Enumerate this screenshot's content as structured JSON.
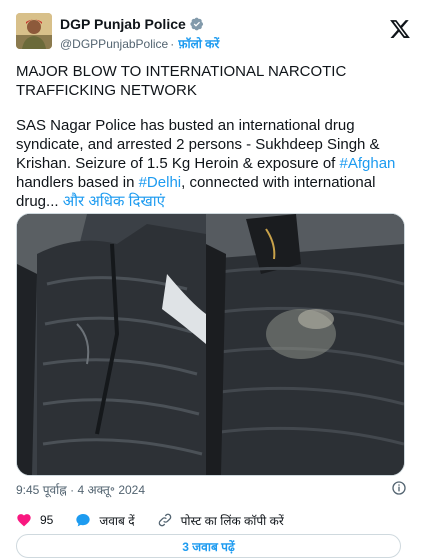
{
  "account": {
    "name": "DGP Punjab Police",
    "handle": "@DGPPunjabPolice",
    "separator": "·",
    "follow_label": "फ़ॉलो करें"
  },
  "tweet": {
    "headline": "MAJOR BLOW TO INTERNATIONAL NARCOTIC TRAFFICKING NETWORK",
    "body_part1": "SAS Nagar Police has busted an international drug syndicate, and arrested 2 persons - Sukhdeep Singh & Krishan. Seizure of 1.5 Kg Heroin & exposure of ",
    "hashtag1": "#Afghan",
    "body_part2": " handlers based in ",
    "hashtag2": "#Delhi",
    "body_part3": ", connected with international drug...",
    "show_more": "और अधिक दिखाएं"
  },
  "meta": {
    "time": "9:45 पूर्वाह्न",
    "separator": "·",
    "date": "4 अक्तू॰ 2024"
  },
  "actions": {
    "likes": "95",
    "reply_label": "जवाब दें",
    "copy_link_label": "पोस्ट का लिंक कॉपी करें"
  },
  "replies_button": "3 जवाब पढ़ें",
  "colors": {
    "accent": "#1d9bf0",
    "like": "#f91880",
    "muted": "#536471"
  }
}
